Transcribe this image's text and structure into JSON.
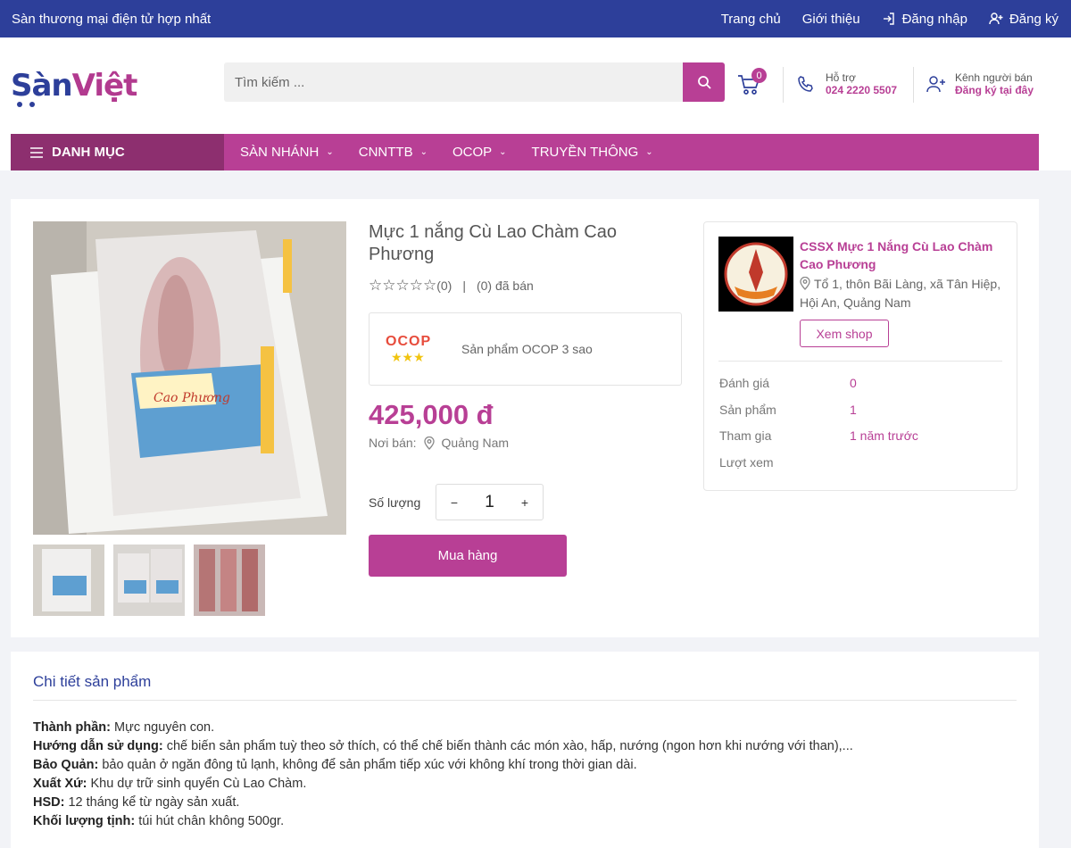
{
  "topbar": {
    "slogan": "Sàn thương mại điện tử hợp nhất",
    "links": [
      "Trang chủ",
      "Giới thiệu",
      "Đăng nhập",
      "Đăng ký"
    ]
  },
  "header": {
    "logo": {
      "part1": "Sàn",
      "part2": "Việt"
    },
    "search_placeholder": "Tìm kiếm ...",
    "cart_count": "0",
    "support_label": "Hỗ trợ",
    "support_phone": "024 2220 5507",
    "seller_label": "Kênh người bán",
    "seller_link": "Đăng ký tại đây"
  },
  "nav": {
    "category_label": "DANH MỤC",
    "items": [
      "SÀN NHÁNH",
      "CNNTTB",
      "OCOP",
      "TRUYỀN THÔNG"
    ]
  },
  "product": {
    "title": "Mực 1 nắng Cù Lao Chàm Cao Phương",
    "stars": "☆☆☆☆☆",
    "rating_count": "(0)",
    "separator": "|",
    "sold": "(0) đã bán",
    "ocop_logo": "OCOP",
    "ocop_stars": "★★★",
    "ocop_text": "Sản phẩm OCOP 3 sao",
    "price": "425,000 đ",
    "origin_label": "Nơi bán:",
    "origin_value": "Quảng Nam",
    "qty_label": "Số lượng",
    "qty_minus": "−",
    "qty_value": "1",
    "qty_plus": "+",
    "buy_label": "Mua hàng"
  },
  "shop": {
    "name": "CSSX Mực 1 Nắng Cù Lao Chàm Cao Phương",
    "address": "Tổ 1, thôn Bãi Làng, xã Tân Hiệp, Hội An, Quảng Nam",
    "view_label": "Xem shop",
    "stats": [
      {
        "k": "Đánh giá",
        "v": "0"
      },
      {
        "k": "Sản phẩm",
        "v": "1"
      },
      {
        "k": "Tham gia",
        "v": "1 năm trước"
      },
      {
        "k": "Lượt xem",
        "v": ""
      }
    ]
  },
  "details": {
    "title": "Chi tiết sản phẩm",
    "rows": [
      {
        "k": "Thành phần:",
        "v": " Mực nguyên con."
      },
      {
        "k": "Hướng dẫn sử dụng:",
        "v": " chế biến sản phẩm tuỳ theo sở thích, có thể chế biến thành các món xào, hấp, nướng (ngon hơn khi nướng với than),..."
      },
      {
        "k": "Bảo Quản:",
        "v": " bảo quản ở ngăn đông tủ lạnh, không để sản phẩm tiếp xúc với không khí trong thời gian dài."
      },
      {
        "k": "Xuất Xứ:",
        "v": " Khu dự trữ sinh quyển Cù Lao Chàm."
      },
      {
        "k": "HSD:",
        "v": " 12 tháng kể từ ngày sản xuất."
      },
      {
        "k": "Khối lượng tịnh:",
        "v": " túi hút chân không 500gr."
      }
    ]
  },
  "colors": {
    "brand": "#b83f95",
    "primary": "#2d3f9a"
  }
}
